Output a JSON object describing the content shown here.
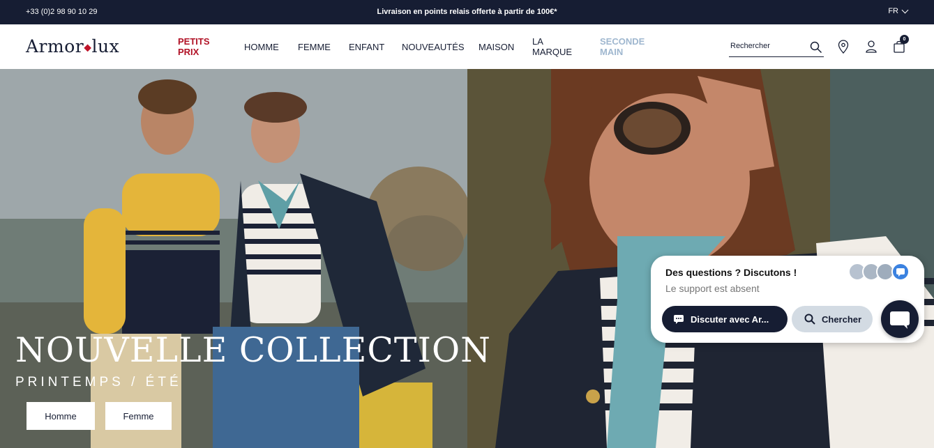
{
  "topbar": {
    "phone": "+33 (0)2 98 90 10 29",
    "promo": "Livraison en points relais offerte à partir de 100€*",
    "language": "FR"
  },
  "header": {
    "logo_left": "Armor",
    "logo_right": "lux",
    "nav": {
      "petits_prix_1": "PETITS",
      "petits_prix_2": "PRIX",
      "homme": "HOMME",
      "femme": "FEMME",
      "enfant": "ENFANT",
      "nouveautes": "NOUVEAUTÉS",
      "maison": "MAISON",
      "la_marque_1": "LA",
      "la_marque_2": "MARQUE",
      "seconde_main_1": "SECONDE",
      "seconde_main_2": "MAIN"
    },
    "search_placeholder": "Rechercher",
    "cart_count": "0"
  },
  "hero": {
    "headline": "NOUVELLE COLLECTION",
    "subline": "PRINTEMPS / ÉTÉ",
    "cta_homme": "Homme",
    "cta_femme": "Femme"
  },
  "chat": {
    "title": "Des questions ? Discutons !",
    "status": "Le support est absent",
    "discuss_button": "Discuter avec Ar...",
    "search_button": "Chercher"
  },
  "colors": {
    "navy": "#161d33",
    "red_accent": "#b11226",
    "light_blue": "#9fb7cf"
  }
}
